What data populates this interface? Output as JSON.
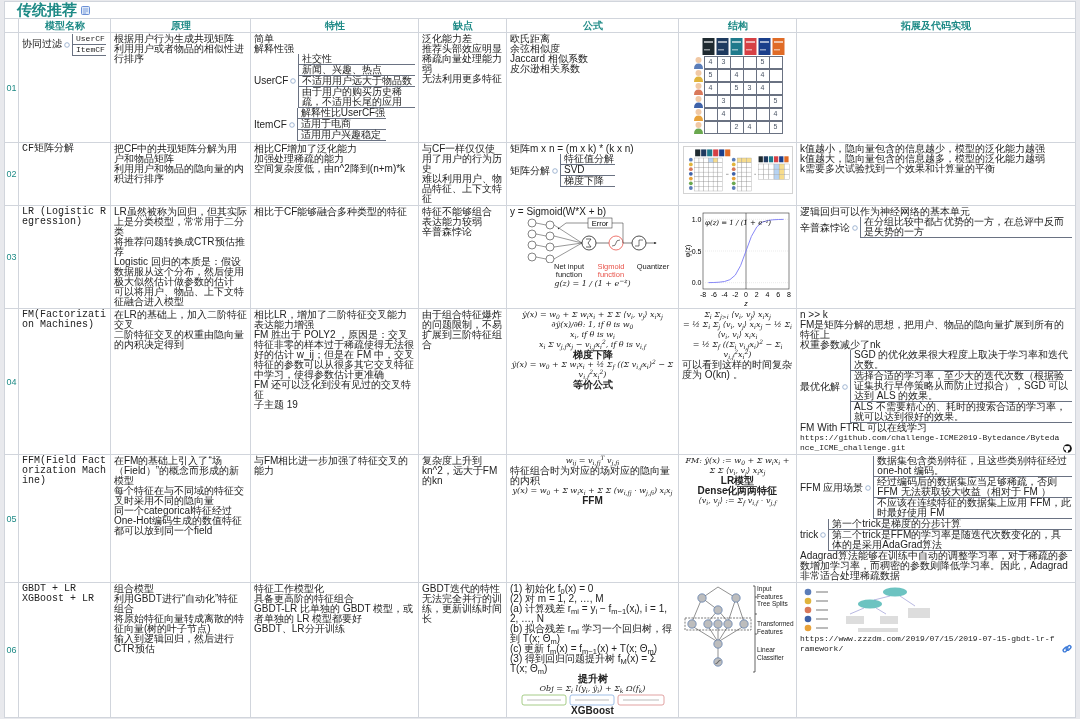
{
  "title": "传统推荐",
  "table": {
    "columns": [
      "模型名称",
      "原理",
      "特性",
      "缺点",
      "公式",
      "结构",
      "拓展及代码实现"
    ],
    "rows": [
      {
        "number": "01",
        "cells": {
          "name": [
            {
              "kind": "branch",
              "label": "协同过滤",
              "children": [
                "UserCF",
                "ItemCF"
              ]
            }
          ],
          "principle": [
            {
              "kind": "text",
              "text": "根据用户行为生成共现矩阵"
            },
            {
              "kind": "text",
              "text": "利用用户或者物品的相似性进行排序"
            }
          ],
          "traits": [
            {
              "kind": "text",
              "text": "简单"
            },
            {
              "kind": "text",
              "text": "解释性强"
            },
            {
              "kind": "branch",
              "label": "UserCF",
              "children": [
                "社交性",
                "新闻、兴趣、热点",
                "不适用用户远大于物品数",
                "由于用户的购买历史稀疏，不适用长尾的应用"
              ]
            },
            {
              "kind": "branch",
              "label": "ItemCF",
              "children": [
                "解释性比UserCF强",
                "适用于电商",
                "适用用户兴趣稳定"
              ]
            }
          ],
          "cons": [
            {
              "kind": "text",
              "text": "泛化能力差"
            },
            {
              "kind": "text",
              "text": "推荐头部效应明显"
            },
            {
              "kind": "text",
              "text": "稀疏向量处理能力弱"
            },
            {
              "kind": "text",
              "text": "无法利用更多特征"
            }
          ],
          "formula": [
            {
              "kind": "text",
              "text": "欧氏距离"
            },
            {
              "kind": "text",
              "text": "余弦相似度"
            },
            {
              "kind": "text",
              "text": "Jaccard 相似系数"
            },
            {
              "kind": "text",
              "text": "皮尔逊相关系数"
            }
          ],
          "structure": [
            {
              "kind": "rating_matrix",
              "rows": [
                [
                  "4",
                  "3",
                  null,
                  null,
                  "5",
                  null
                ],
                [
                  "5",
                  null,
                  "4",
                  null,
                  "4",
                  null
                ],
                [
                  "4",
                  null,
                  "5",
                  "3",
                  "4",
                  null
                ],
                [
                  null,
                  "3",
                  null,
                  null,
                  null,
                  "5"
                ],
                [
                  null,
                  "4",
                  null,
                  null,
                  null,
                  "4"
                ],
                [
                  null,
                  null,
                  "2",
                  "4",
                  null,
                  "5"
                ]
              ]
            }
          ]
        }
      },
      {
        "number": "02",
        "cells": {
          "name": [
            {
              "kind": "text",
              "text": "CF矩阵分解"
            }
          ],
          "principle": [
            {
              "kind": "text",
              "text": "把CF中的共现矩阵分解为用户和物品矩阵"
            },
            {
              "kind": "text",
              "text": "利用用户和物品的隐向量的内积进行排序"
            }
          ],
          "traits": [
            {
              "kind": "text",
              "text": "相比CF增加了泛化能力"
            },
            {
              "kind": "text",
              "text": "加强处理稀疏的能力"
            },
            {
              "kind": "text",
              "text": "空间复杂度低，由n^2降到(n+m)*k"
            }
          ],
          "cons": [
            {
              "kind": "text",
              "text": "与CF一样仅仅使用了用户的行为历史"
            },
            {
              "kind": "text",
              "text": "难以利用用户、物品特征、上下文特征"
            }
          ],
          "formula": [
            {
              "kind": "text",
              "text": "矩阵m x n = (m x k) * (k x n)"
            },
            {
              "kind": "branch",
              "label": "矩阵分解",
              "children": [
                "特征值分解",
                "SVD",
                "梯度下降"
              ]
            }
          ],
          "structure": [
            {
              "kind": "factorization"
            }
          ],
          "extension": [
            {
              "kind": "text",
              "text": "k值越小，隐向量包含的信息越少，模型的泛化能力越强"
            },
            {
              "kind": "text",
              "text": "k值越大，隐向量包含的信息越多，模型的泛化能力越弱"
            },
            {
              "kind": "text",
              "text": "k需要多次试验找到一个效果和计算量的平衡"
            }
          ]
        }
      },
      {
        "number": "03",
        "cells": {
          "name": [
            {
              "kind": "text",
              "text": "LR (Logistic Regression)"
            }
          ],
          "principle": [
            {
              "kind": "text",
              "text": "LR虽然被称为回归，但其实际上是分类模型，常常用于二分类"
            },
            {
              "kind": "text",
              "text": "将推荐问题转换成CTR预估推荐"
            },
            {
              "kind": "text",
              "text": "Logistic 回归的本质是：假设数据服从这个分布，然后使用极大似然估计做参数的估计"
            },
            {
              "kind": "text",
              "text": "可以将用户、物品、上下文特征融合进入模型"
            }
          ],
          "traits": [
            {
              "kind": "text",
              "text": "相比于CF能够融合多种类型的特征"
            }
          ],
          "cons": [
            {
              "kind": "text",
              "text": "特征不能够组合"
            },
            {
              "kind": "text",
              "text": "表达能力较弱"
            },
            {
              "kind": "text",
              "text": "辛普森悖论"
            }
          ],
          "formula": [
            {
              "kind": "text",
              "text": "y = Sigmoid(W*X + b)"
            },
            {
              "kind": "perceptron",
              "box": "Error",
              "labels": [
                "Net input function",
                "Sigmoid function",
                "Quantizer"
              ]
            },
            {
              "kind": "math",
              "text": "g(z) = 1 / (1 + e$^{−z}$)"
            }
          ],
          "structure": [
            {
              "kind": "sigmoid_chart",
              "chart_data": {
                "type": "line",
                "xlabel": "z",
                "ylabel": "φ(z)",
                "x": [
                  -7,
                  -6,
                  -5,
                  -4,
                  -3,
                  -2,
                  -1,
                  0,
                  1,
                  2,
                  3,
                  4,
                  5,
                  6,
                  7
                ],
                "series": [
                  {
                    "color": "#7b7bf5",
                    "values": [
                      0.001,
                      0.002,
                      0.007,
                      0.018,
                      0.047,
                      0.119,
                      0.269,
                      0.5,
                      0.731,
                      0.881,
                      0.953,
                      0.982,
                      0.993,
                      0.998,
                      0.999
                    ]
                  }
                ],
                "grid": true,
                "xlim": [
                  -8,
                  8
                ],
                "ylim": [
                  -0.1,
                  1.1
                ],
                "xticks": [
                  -8,
                  -6,
                  -4,
                  -2,
                  0,
                  2,
                  4,
                  6,
                  8
                ],
                "yticks": [
                  {
                    "value": 0,
                    "label": "0.0"
                  },
                  {
                    "value": 0.5,
                    "label": "0.5"
                  },
                  {
                    "value": 1,
                    "label": "1.0"
                  }
                ],
                "annotations": [
                  {
                    "text": "φ(z) = 1 / (1 + e⁻ᶻ)"
                  }
                ]
              }
            }
          ],
          "extension": [
            {
              "kind": "text",
              "text": "逻辑回归可以作为神经网络的基本单元"
            },
            {
              "kind": "branch",
              "label": "辛普森悖论",
              "children": [
                "在分组比较中都占优势的一方，在总评中反而是失势的一方"
              ]
            }
          ]
        }
      },
      {
        "number": "04",
        "cells": {
          "name": [
            {
              "kind": "text",
              "text": "FM(Factorization Machines)"
            }
          ],
          "principle": [
            {
              "kind": "text",
              "text": "在LR的基础上，加入二阶特征交叉"
            },
            {
              "kind": "text",
              "text": "二阶特征交叉的权重由隐向量的内积决定得到"
            }
          ],
          "traits": [
            {
              "kind": "text",
              "text": "相比LR，增加了二阶特征交叉能力"
            },
            {
              "kind": "text",
              "text": "表达能力增强"
            },
            {
              "kind": "text",
              "text": "FM 胜出于 POLY2 ，原因是：交叉特征非零的样本过于稀疏使得无法很好的估计 w_ij；但是在 FM 中，交叉特征的参数可以从很多其它交叉特征中学习，使得参数估计更准确"
            },
            {
              "kind": "text",
              "text": "FM 还可以泛化到没有见过的交叉特征"
            },
            {
              "kind": "text",
              "text": "子主题 19"
            }
          ],
          "cons": [
            {
              "kind": "text",
              "text": "由于组合特征爆炸的问题限制，不易扩展到三阶特征组合"
            }
          ],
          "formula": [
            {
              "kind": "math",
              "text": "ŷ(x) = w$_{0}$ + Σ w$_{i}$x$_{i}$ + Σ Σ ⟨v$_{i}$, v$_{j}$⟩ x$_{i}$x$_{j}$"
            },
            {
              "kind": "math",
              "text": "∂ŷ(x)/∂θ: 1, if θ is w$_{0}$"
            },
            {
              "kind": "math",
              "text": "x$_{i}$, if θ is w$_{i}$"
            },
            {
              "kind": "math",
              "text": "x$_{i}$ Σ v$_{j,f}$x$_{j}$ − v$_{i,f}$x$_{i}$$^{2}$, if θ is v$_{i,f}$"
            },
            {
              "kind": "caption",
              "text": "梯度下降"
            },
            {
              "kind": "math",
              "text": "ŷ(x) = w$_{0}$ + Σ w$_{i}$x$_{i}$ + ½ Σ$_{f}$ ((Σ v$_{i,f}$x$_{i}$)$^{2}$ − Σ v$_{i,f}$$^{2}$x$_{i}$$^{2}$)"
            },
            {
              "kind": "caption",
              "text": "等价公式"
            }
          ],
          "structure": [
            {
              "kind": "math",
              "text": "Σ$_{i}$ Σ$_{j>i}$ ⟨v$_{i}$, v$_{j}$⟩ x$_{i}$x$_{j}$"
            },
            {
              "kind": "math",
              "text": "= ½ Σ$_{i}$ Σ$_{j}$ ⟨v$_{i}$, v$_{j}$⟩ x$_{i}$x$_{j}$ − ½ Σ$_{i}$ ⟨v$_{i}$, v$_{i}$⟩ x$_{i}$x$_{i}$"
            },
            {
              "kind": "math",
              "text": "= ½ Σ$_{f}$ ((Σ$_{i}$ v$_{i,f}$x$_{i}$)$^{2}$ − Σ$_{i}$ v$_{i,f}$$^{2}$x$_{i}$$^{2}$)"
            },
            {
              "kind": "text",
              "text": "可以看到这样的时间复杂度为 O(kn) 。"
            }
          ],
          "extension": [
            {
              "kind": "text",
              "text": "n >> k"
            },
            {
              "kind": "text",
              "text": "FM是矩阵分解的思想，把用户、物品的隐向量扩展到所有的特征上"
            },
            {
              "kind": "text",
              "text": "权重参数减少了nk"
            },
            {
              "kind": "branch",
              "label": "最优化解",
              "children": [
                "SGD 的优化效果很大程度上取决于学习率和迭代次数。",
                "选择合适的学习率，至少大的迭代次数（根据验证集执行早停策略从而防止过拟合），SGD 可以达到 ALS 的效果。",
                "ALS 不需要精心的、耗时的搜索合适的学习率，就可以达到很好的效果。"
              ]
            },
            {
              "kind": "text",
              "text": "FM With FTRL 可以在线学习"
            },
            {
              "kind": "repo_link",
              "text": "https://github.com/challenge-ICME2019-Bytedance/Bytedance_ICME_challenge.git"
            }
          ]
        }
      },
      {
        "number": "05",
        "cells": {
          "name": [
            {
              "kind": "text",
              "text": "FFM(Field Factorization Machine)"
            }
          ],
          "principle": [
            {
              "kind": "text",
              "text": "在FM的基础上引入了“场（Field）”的概念而形成的新模型"
            },
            {
              "kind": "text",
              "text": "每个特征在与不同域的特征交叉时采用不同的隐向量"
            },
            {
              "kind": "text",
              "text": "同一个categorical特征经过One-Hot编码生成的数值特征都可以放到同一个field"
            }
          ],
          "traits": [
            {
              "kind": "text",
              "text": "与FM相比进一步加强了特征交叉的能力"
            }
          ],
          "cons": [
            {
              "kind": "text",
              "text": "复杂度上升到kn^2，远大于FM的kn"
            }
          ],
          "formula": [
            {
              "kind": "math",
              "text": "w$_{ij}$ = v$_{i,fj}$$^{T}$ v$_{j,fi}$"
            },
            {
              "kind": "text",
              "text": "特征组合时为对应的场对应的隐向量的内积"
            },
            {
              "kind": "math",
              "text": "y(x) = w$_{0}$ + Σ w$_{i}$x$_{i}$ + Σ Σ (w$_{i,fj}$ · w$_{j,fi}$) x$_{i}$x$_{j}$"
            },
            {
              "kind": "caption",
              "text": "FFM"
            }
          ],
          "structure": [
            {
              "kind": "math",
              "text": "FM: ŷ(x) := w$_{0}$ + Σ w$_{i}$x$_{i}$ + Σ Σ ⟨v$_{i}$, v$_{j}$⟩ x$_{i}$x$_{j}$"
            },
            {
              "kind": "caption",
              "text": "LR模型"
            },
            {
              "kind": "caption",
              "text": "Dense化两两特征"
            },
            {
              "kind": "math",
              "text": "⟨v$_{i}$, v$_{j}$⟩ := Σ$_{f}$ v$_{i,f}$ · v$_{j,f}$"
            }
          ],
          "extension": [
            {
              "kind": "branch",
              "label": "FFM 应用场景",
              "children": [
                "数据集包含类别特征，且这些类别特征经过one-hot 编码。",
                "经过编码后的数据集应当足够稀疏，否则 FFM 无法获取较大收益（相对于 FM ）",
                "不应该在连续特征的数据集上应用 FFM，此时最好使用 FM"
              ]
            },
            {
              "kind": "branch",
              "label": "trick",
              "children": [
                "第一个trick是梯度的分步计算",
                "第二个trick是FFM的学习率是随迭代次数变化的，具体的是采用AdaGrad算法"
              ]
            },
            {
              "kind": "text",
              "text": "Adagrad算法能够在训练中自动的调整学习率，对于稀疏的参数增加学习率，而稠密的参数则降低学习率。因此，Adagrad非常适合处理稀疏数据"
            }
          ]
        }
      },
      {
        "number": "06",
        "cells": {
          "name": [
            {
              "kind": "text",
              "text": "GBDT + LR"
            },
            {
              "kind": "text",
              "text": "XGBoost + LR"
            }
          ],
          "principle": [
            {
              "kind": "text",
              "text": "组合模型"
            },
            {
              "kind": "text",
              "text": "利用GBDT进行“自动化”特征组合"
            },
            {
              "kind": "text",
              "text": "将原始特征向量转成离散的特征向量(树的叶子节点)"
            },
            {
              "kind": "text",
              "text": "输入到逻辑回归，然后进行CTR预估"
            }
          ],
          "traits": [
            {
              "kind": "text",
              "text": "特征工作模型化"
            },
            {
              "kind": "text",
              "text": "具备更高阶的特征组合"
            },
            {
              "kind": "text",
              "text": "GBDT-LR 比单独的 GBDT 模型，或者单独的 LR 模型都要好"
            },
            {
              "kind": "text",
              "text": "GBDT、LR分开训练"
            }
          ],
          "cons": [
            {
              "kind": "text",
              "text": "GBDT迭代的特性无法完全并行的训练，更新训练时间长"
            }
          ],
          "formula": [
            {
              "kind": "text",
              "text": "(1) 初始化 f$_{0}$(x) = 0"
            },
            {
              "kind": "text",
              "text": "(2) 对 m = 1, 2, …, M"
            },
            {
              "kind": "text",
              "text": "(a) 计算残差 r$_{mi}$ = y$_{i}$ − f$_{m−1}$(x$_{i}$), i = 1, 2, …, N"
            },
            {
              "kind": "text",
              "text": "(b) 拟合残差 r$_{mi}$ 学习一个回归树，得到 T(x; Θ$_{m}$)"
            },
            {
              "kind": "text",
              "text": "(c) 更新 f$_{m}$(x) = f$_{m−1}$(x) + T(x; Θ$_{m}$)"
            },
            {
              "kind": "text",
              "text": "(3) 得到回归问题提升树 f$_{M}$(x) = Σ T(x; Θ$_{m}$)"
            },
            {
              "kind": "caption",
              "text": "提升树"
            },
            {
              "kind": "math",
              "text": "Obj = Σ$_{i}$ l(y$_{i}$, ŷ$_{i}$) + Σ$_{k}$ Ω(f$_{k}$)"
            },
            {
              "kind": "formula_boxes"
            },
            {
              "kind": "caption",
              "text": "XGBoost"
            }
          ],
          "structure": [
            {
              "kind": "gbdt_diagram",
              "labels": [
                "Input Features",
                "Tree Splits",
                "Transformed Features",
                "Linear Classifier"
              ]
            }
          ],
          "extension": [
            {
              "kind": "tree_example"
            },
            {
              "kind": "web_link",
              "text": "https://www.zzzdm.com/2019/07/15/2019-07-15-gbdt-lr-framework/"
            }
          ]
        }
      }
    ]
  }
}
